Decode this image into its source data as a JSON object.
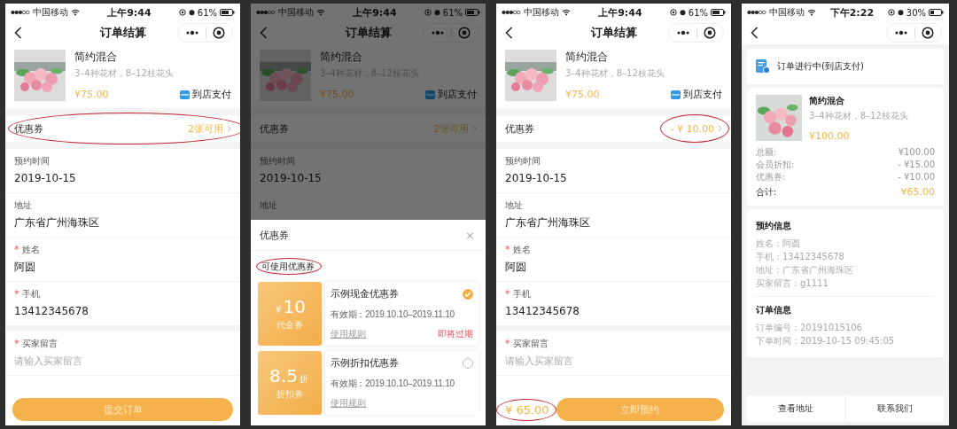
{
  "screens": [
    {
      "kind": "checkout",
      "status_bar": {
        "carrier": "中国移动",
        "time": "上午9:44",
        "battery": "61%"
      },
      "nav": {
        "title": "订单结算"
      },
      "product": {
        "name": "简约混合",
        "spec": "3–4种花材，8–12枝花头",
        "price": "¥75.00",
        "payment": "到店支付"
      },
      "coupon_row": {
        "label": "优惠券",
        "value": "2张可用",
        "circled": true
      },
      "fields": [
        {
          "label": "预约时间",
          "value": "2019-10-15"
        },
        {
          "label": "地址",
          "value": "广东省广州海珠区"
        },
        {
          "mark": "*",
          "label": "姓名",
          "value": "阿圆"
        },
        {
          "mark": "*",
          "label": "手机",
          "value": "13412345678"
        }
      ],
      "message": {
        "mark": "*",
        "label": "买家留言",
        "placeholder": "请输入买家留言"
      },
      "footer": {
        "submit": "提交订单"
      }
    },
    {
      "kind": "checkout",
      "dimmed": true,
      "status_bar": {
        "carrier": "中国移动",
        "time": "上午9:44",
        "battery": "61%"
      },
      "nav": {
        "title": "订单结算"
      },
      "product": {
        "name": "简约混合",
        "spec": "3–4种花材，8–12枝花头",
        "price": "¥75.00",
        "payment": "到店支付"
      },
      "coupon_row": {
        "label": "优惠券",
        "value": "2张可用"
      },
      "fields": [
        {
          "label": "预约时间",
          "value": "2019-10-15"
        },
        {
          "label": "地址"
        }
      ],
      "sheet": {
        "title": "优惠券",
        "close": "×",
        "heading": "可使用优惠券",
        "heading_circled": true,
        "coupons": [
          {
            "prefix": "¥",
            "value": "10",
            "type": "代金券",
            "title": "示例现金优惠券",
            "validity": "有效期：2019.10.10–2019.11.10",
            "rules": "使用规则",
            "tag": "即将过期",
            "selected": true
          },
          {
            "value": "8.5",
            "suffix": "折",
            "type": "折扣券",
            "title": "示例折扣优惠券",
            "validity": "有效期：2019.10.10–2019.11.10",
            "rules": "使用规则",
            "selected": false
          }
        ]
      }
    },
    {
      "kind": "checkout",
      "status_bar": {
        "carrier": "中国移动",
        "time": "上午9:44",
        "battery": "61%"
      },
      "nav": {
        "title": "订单结算"
      },
      "product": {
        "name": "简约混合",
        "spec": "3–4种花材，8–12枝花头",
        "price": "¥75.00",
        "payment": "到店支付"
      },
      "coupon_row": {
        "label": "优惠券",
        "value": "- ¥ 10.00",
        "circled": true
      },
      "fields": [
        {
          "label": "预约时间",
          "value": "2019-10-15"
        },
        {
          "label": "地址",
          "value": "广东省广州海珠区"
        },
        {
          "mark": "*",
          "label": "姓名",
          "value": "阿圆"
        },
        {
          "mark": "*",
          "label": "手机",
          "value": "13412345678"
        }
      ],
      "message": {
        "mark": "*",
        "label": "买家留言",
        "placeholder": "请输入买家留言"
      },
      "footer": {
        "total": "¥ 65.00",
        "total_circled": true,
        "submit": "立即预约"
      }
    },
    {
      "kind": "order_detail",
      "status_bar": {
        "carrier": "中国移动",
        "time": "下午2:22",
        "battery": "30%"
      },
      "status": "订单进行中(到店支付)",
      "product": {
        "name": "简约混合",
        "spec": "3–4种花材，8–12枝花头",
        "price": "¥100.00"
      },
      "summary": [
        {
          "label": "总额:",
          "value": "¥100.00"
        },
        {
          "label": "会员折扣:",
          "value": "- ¥15.00"
        },
        {
          "label": "优惠券:",
          "value": "- ¥10.00"
        }
      ],
      "total": {
        "label": "合计:",
        "value": "¥65.00"
      },
      "sections": [
        {
          "title": "预约信息",
          "lines": [
            "姓名：阿圆",
            "手机：13412345678",
            "地址：广东省广州海珠区",
            "买家留言：g1111"
          ]
        },
        {
          "title": "订单信息",
          "lines": [
            "订单编号：20191015106",
            "下单时间：2019-10-15 09:45:05"
          ]
        }
      ],
      "actions": [
        "查看地址",
        "联系我们"
      ]
    }
  ]
}
